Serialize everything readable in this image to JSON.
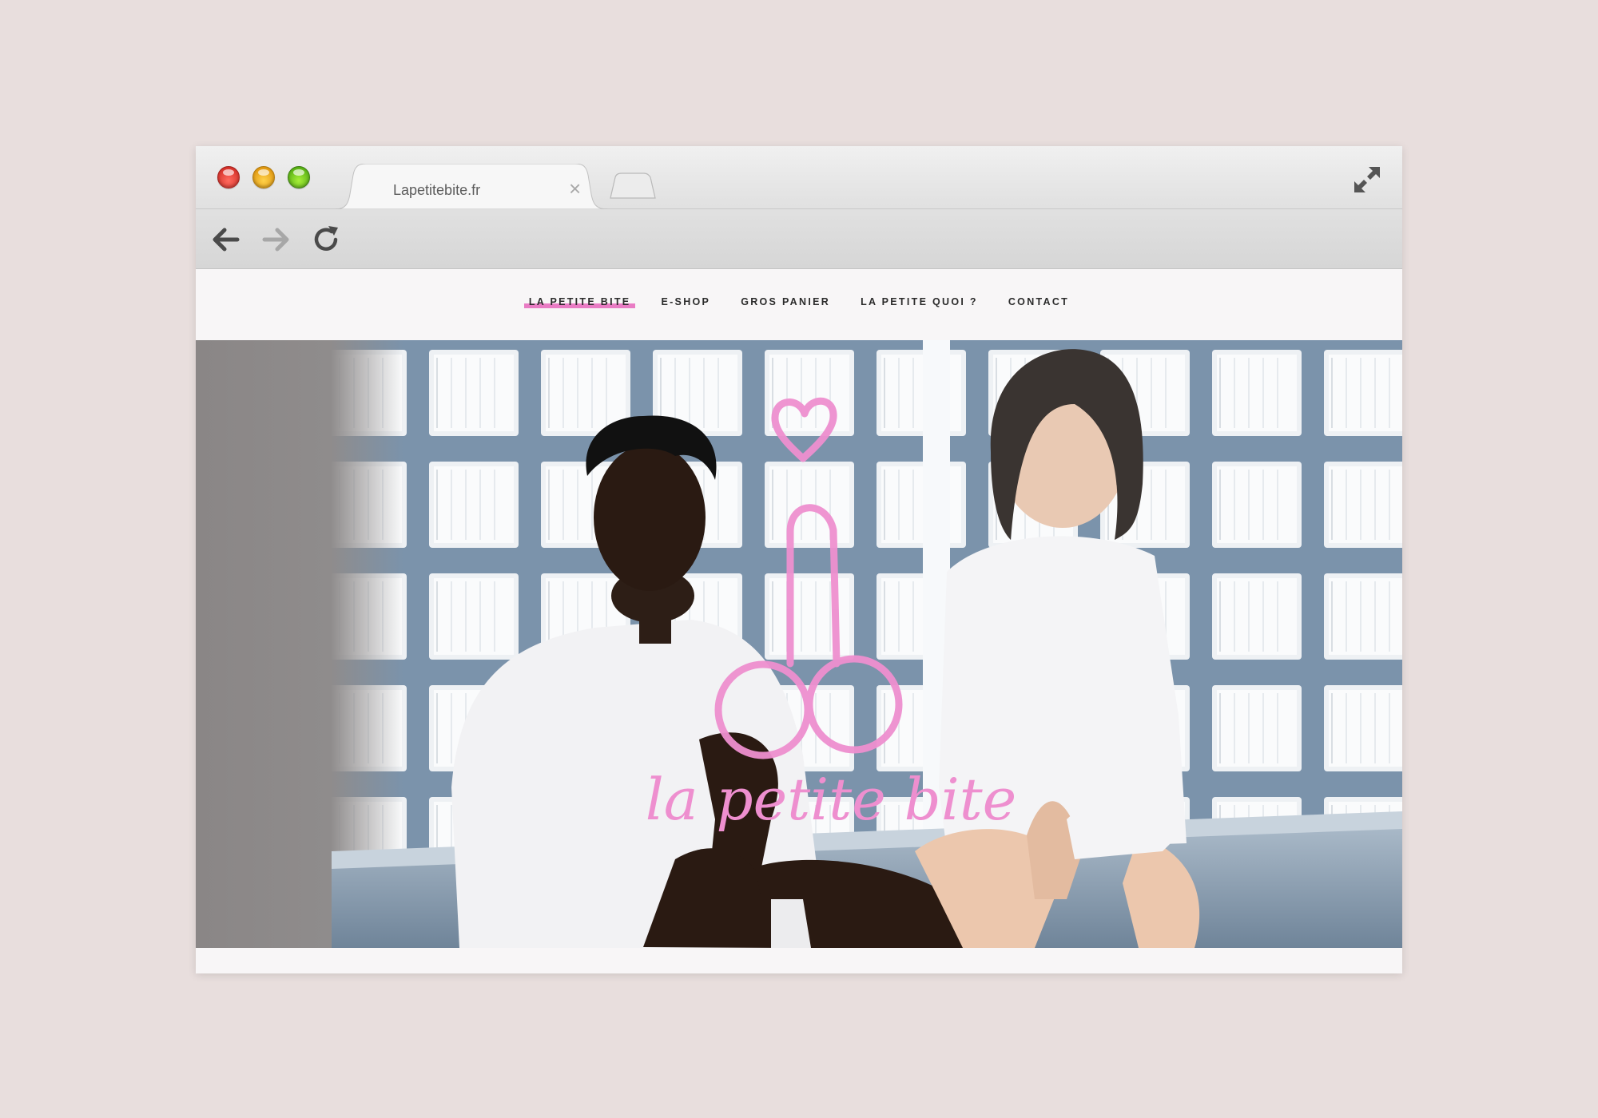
{
  "browser": {
    "tab_title": "Lapetitebite.fr",
    "tab_close": "×"
  },
  "site": {
    "nav": [
      {
        "label": "LA PETITE BITE",
        "active": true
      },
      {
        "label": "E-SHOP",
        "active": false
      },
      {
        "label": "GROS PANIER",
        "active": false
      },
      {
        "label": "LA PETITE QUOI ?",
        "active": false
      },
      {
        "label": "CONTACT",
        "active": false
      }
    ],
    "hero_logo_text": "la petite bite"
  },
  "colors": {
    "accent_pink": "#e97cc4",
    "background": "#e8dedd"
  },
  "icons": {
    "back": "arrow-left-icon",
    "forward": "arrow-right-icon",
    "reload": "reload-icon",
    "fullscreen": "fullscreen-icon"
  }
}
